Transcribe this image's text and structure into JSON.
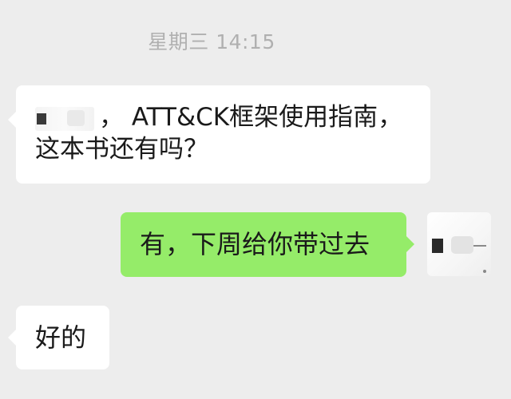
{
  "chat": {
    "timestamp": "星期三 14:15",
    "messages": [
      {
        "sender": "other",
        "lines": [
          "，  ATT&CK框架使用指南，",
          "这本书还有吗？"
        ]
      },
      {
        "sender": "self",
        "text": "有，下周给你带过去"
      },
      {
        "sender": "other",
        "text": "好的"
      }
    ]
  },
  "colors": {
    "background": "#ededed",
    "incoming_bubble": "#ffffff",
    "outgoing_bubble": "#95ec69",
    "timestamp_text": "#b0b0b0",
    "message_text": "#1a1a1a"
  }
}
